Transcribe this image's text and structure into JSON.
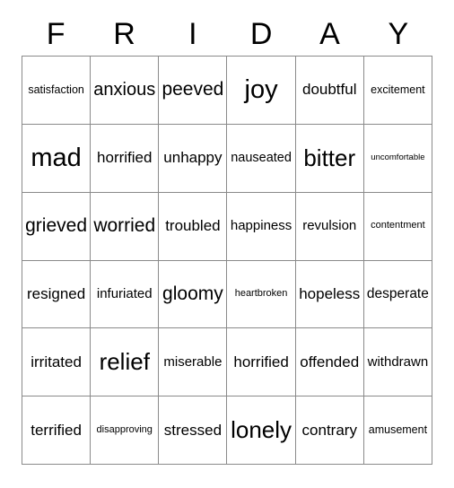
{
  "card": {
    "title_letters": [
      "F",
      "R",
      "I",
      "D",
      "A",
      "Y"
    ],
    "columns": 6,
    "rows": 6,
    "border_color": "#8a8a8a",
    "text_color": "#000000",
    "background_color": "#ffffff",
    "cells": [
      [
        {
          "label": "satisfaction",
          "size": "xs"
        },
        {
          "label": "anxious",
          "size": "l"
        },
        {
          "label": "peeved",
          "size": "l"
        },
        {
          "label": "joy",
          "size": "xxl"
        },
        {
          "label": "doubtful",
          "size": "m"
        },
        {
          "label": "excitement",
          "size": "xs"
        }
      ],
      [
        {
          "label": "mad",
          "size": "xxl"
        },
        {
          "label": "horrified",
          "size": "m"
        },
        {
          "label": "unhappy",
          "size": "m"
        },
        {
          "label": "nauseated",
          "size": "s"
        },
        {
          "label": "bitter",
          "size": "xl"
        },
        {
          "label": "uncomfortable",
          "size": "min"
        }
      ],
      [
        {
          "label": "grieved",
          "size": "l"
        },
        {
          "label": "worried",
          "size": "l"
        },
        {
          "label": "troubled",
          "size": "m"
        },
        {
          "label": "happiness",
          "size": "s"
        },
        {
          "label": "revulsion",
          "size": "s"
        },
        {
          "label": "contentment",
          "size": "xxs"
        }
      ],
      [
        {
          "label": "resigned",
          "size": "m"
        },
        {
          "label": "infuriated",
          "size": "s"
        },
        {
          "label": "gloomy",
          "size": "l"
        },
        {
          "label": "heartbroken",
          "size": "xxs"
        },
        {
          "label": "hopeless",
          "size": "m"
        },
        {
          "label": "desperate",
          "size": "m"
        }
      ],
      [
        {
          "label": "irritated",
          "size": "m"
        },
        {
          "label": "relief",
          "size": "xl"
        },
        {
          "label": "miserable",
          "size": "s"
        },
        {
          "label": "horrified",
          "size": "m"
        },
        {
          "label": "offended",
          "size": "m"
        },
        {
          "label": "withdrawn",
          "size": "s"
        }
      ],
      [
        {
          "label": "terrified",
          "size": "m"
        },
        {
          "label": "disapproving",
          "size": "xxs"
        },
        {
          "label": "stressed",
          "size": "m"
        },
        {
          "label": "lonely",
          "size": "xl"
        },
        {
          "label": "contrary",
          "size": "m"
        },
        {
          "label": "amusement",
          "size": "xs"
        }
      ]
    ]
  }
}
